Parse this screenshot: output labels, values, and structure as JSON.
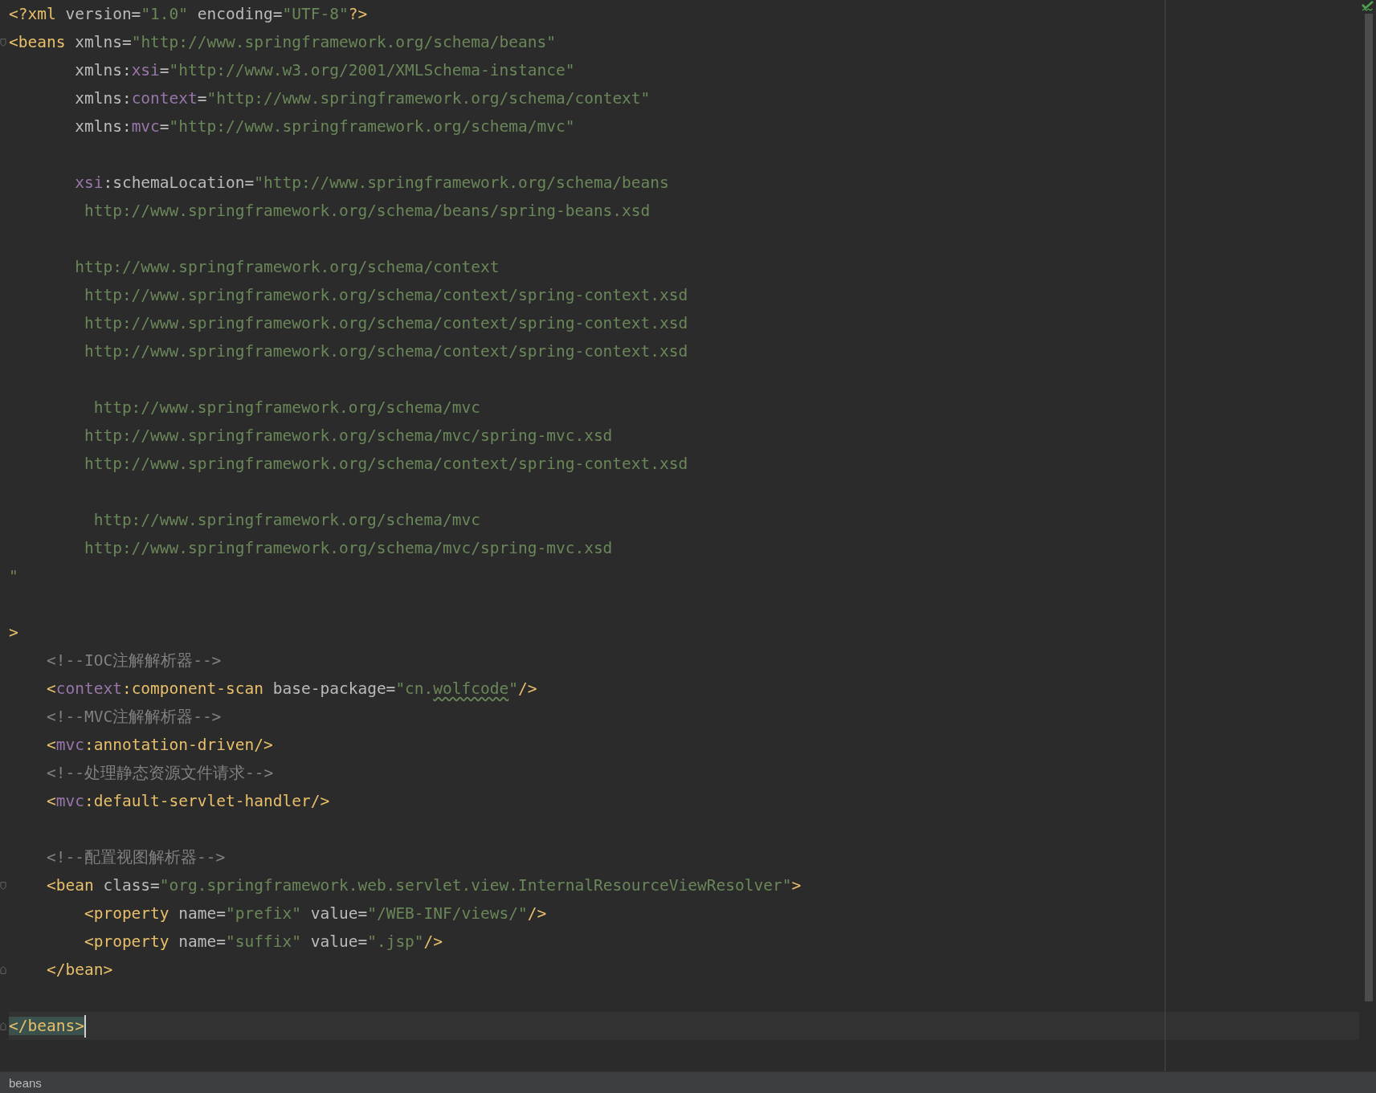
{
  "editor": {
    "lines": [
      {
        "kind": "plain",
        "current": false,
        "tokens": [
          {
            "kind": "tag",
            "text": "<?xml"
          },
          {
            "kind": "attr",
            "text": " version="
          },
          {
            "kind": "value",
            "text": "\"1.0\""
          },
          {
            "kind": "attr",
            "text": " encoding="
          },
          {
            "kind": "value",
            "text": "\"UTF-8\""
          },
          {
            "kind": "tag",
            "text": "?>"
          }
        ]
      },
      {
        "kind": "fold-start",
        "current": false,
        "tokens": [
          {
            "kind": "tag",
            "text": "<beans"
          },
          {
            "kind": "attr",
            "text": " xmlns="
          },
          {
            "kind": "value",
            "text": "\"http://www.springframework.org/schema/beans\""
          }
        ]
      },
      {
        "kind": "plain",
        "current": false,
        "tokens": [
          {
            "kind": "attr",
            "text": "       xmlns:"
          },
          {
            "kind": "ns",
            "text": "xsi"
          },
          {
            "kind": "attr",
            "text": "="
          },
          {
            "kind": "value",
            "text": "\"http://www.w3.org/2001/XMLSchema-instance\""
          }
        ]
      },
      {
        "kind": "plain",
        "current": false,
        "tokens": [
          {
            "kind": "attr",
            "text": "       xmlns:"
          },
          {
            "kind": "ns",
            "text": "context"
          },
          {
            "kind": "attr",
            "text": "="
          },
          {
            "kind": "value",
            "text": "\"http://www.springframework.org/schema/context\""
          }
        ]
      },
      {
        "kind": "plain",
        "current": false,
        "tokens": [
          {
            "kind": "attr",
            "text": "       xmlns:"
          },
          {
            "kind": "ns",
            "text": "mvc"
          },
          {
            "kind": "attr",
            "text": "="
          },
          {
            "kind": "value",
            "text": "\"http://www.springframework.org/schema/mvc\""
          }
        ]
      },
      {
        "kind": "plain",
        "current": false
      },
      {
        "kind": "plain",
        "current": false,
        "tokens": [
          {
            "kind": "ns",
            "text": "       xsi"
          },
          {
            "kind": "attr",
            "text": ":schemaLocation="
          },
          {
            "kind": "value",
            "text": "\"http://www.springframework.org/schema/beans"
          }
        ]
      },
      {
        "kind": "plain",
        "current": false,
        "tokens": [
          {
            "kind": "value",
            "text": "        http://www.springframework.org/schema/beans/spring-beans.xsd"
          }
        ]
      },
      {
        "kind": "plain",
        "current": false
      },
      {
        "kind": "plain",
        "current": false,
        "tokens": [
          {
            "kind": "value",
            "text": "       http://www.springframework.org/schema/context"
          }
        ]
      },
      {
        "kind": "plain",
        "current": false,
        "tokens": [
          {
            "kind": "value",
            "text": "        http://www.springframework.org/schema/context/spring-context.xsd"
          }
        ]
      },
      {
        "kind": "plain",
        "current": false,
        "tokens": [
          {
            "kind": "value",
            "text": "        http://www.springframework.org/schema/context/spring-context.xsd"
          }
        ]
      },
      {
        "kind": "plain",
        "current": false,
        "tokens": [
          {
            "kind": "value",
            "text": "        http://www.springframework.org/schema/context/spring-context.xsd"
          }
        ]
      },
      {
        "kind": "plain",
        "current": false
      },
      {
        "kind": "plain",
        "current": false,
        "tokens": [
          {
            "kind": "value",
            "text": "         http://www.springframework.org/schema/mvc"
          }
        ]
      },
      {
        "kind": "plain",
        "current": false,
        "tokens": [
          {
            "kind": "value",
            "text": "        http://www.springframework.org/schema/mvc/spring-mvc.xsd"
          }
        ]
      },
      {
        "kind": "plain",
        "current": false,
        "tokens": [
          {
            "kind": "value",
            "text": "        http://www.springframework.org/schema/context/spring-context.xsd"
          }
        ]
      },
      {
        "kind": "plain",
        "current": false
      },
      {
        "kind": "plain",
        "current": false,
        "tokens": [
          {
            "kind": "value",
            "text": "         http://www.springframework.org/schema/mvc"
          }
        ]
      },
      {
        "kind": "plain",
        "current": false,
        "tokens": [
          {
            "kind": "value",
            "text": "        http://www.springframework.org/schema/mvc/spring-mvc.xsd"
          }
        ]
      },
      {
        "kind": "plain",
        "current": false,
        "tokens": [
          {
            "kind": "value",
            "text": "\""
          }
        ]
      },
      {
        "kind": "plain",
        "current": false
      },
      {
        "kind": "plain",
        "current": false,
        "tokens": [
          {
            "kind": "tag",
            "text": ">"
          }
        ]
      },
      {
        "kind": "plain",
        "current": false,
        "tokens": [
          {
            "kind": "comment",
            "text": "    <!--IOC注解解析器-->"
          }
        ]
      },
      {
        "kind": "plain",
        "current": false,
        "tokens": [
          {
            "kind": "tag",
            "text": "    <"
          },
          {
            "kind": "ns",
            "text": "context"
          },
          {
            "kind": "tag",
            "text": ":component-scan"
          },
          {
            "kind": "attr",
            "text": " base-package="
          },
          {
            "kind": "value",
            "text": "\"cn."
          },
          {
            "kind": "typo",
            "text": "wolfcode"
          },
          {
            "kind": "value",
            "text": "\""
          },
          {
            "kind": "tag",
            "text": "/>"
          }
        ]
      },
      {
        "kind": "plain",
        "current": false,
        "tokens": [
          {
            "kind": "comment",
            "text": "    <!--MVC注解解析器-->"
          }
        ]
      },
      {
        "kind": "plain",
        "current": false,
        "tokens": [
          {
            "kind": "tag",
            "text": "    <"
          },
          {
            "kind": "ns",
            "text": "mvc"
          },
          {
            "kind": "tag",
            "text": ":annotation-driven/>"
          }
        ]
      },
      {
        "kind": "plain",
        "current": false,
        "tokens": [
          {
            "kind": "comment",
            "text": "    <!--处理静态资源文件请求-->"
          }
        ]
      },
      {
        "kind": "plain",
        "current": false,
        "tokens": [
          {
            "kind": "tag",
            "text": "    <"
          },
          {
            "kind": "ns",
            "text": "mvc"
          },
          {
            "kind": "tag",
            "text": ":default-servlet-handler/>"
          }
        ]
      },
      {
        "kind": "plain",
        "current": false
      },
      {
        "kind": "plain",
        "current": false,
        "tokens": [
          {
            "kind": "comment",
            "text": "    <!--配置视图解析器-->"
          }
        ]
      },
      {
        "kind": "fold-start",
        "current": false,
        "tokens": [
          {
            "kind": "tag",
            "text": "    <bean"
          },
          {
            "kind": "attr",
            "text": " class="
          },
          {
            "kind": "value",
            "text": "\"org.springframework.web.servlet.view.InternalResourceViewResolver\""
          },
          {
            "kind": "tag",
            "text": ">"
          }
        ]
      },
      {
        "kind": "plain",
        "current": false,
        "tokens": [
          {
            "kind": "tag",
            "text": "        <property"
          },
          {
            "kind": "attr",
            "text": " name="
          },
          {
            "kind": "value",
            "text": "\"prefix\""
          },
          {
            "kind": "attr",
            "text": " value="
          },
          {
            "kind": "value",
            "text": "\"/WEB-INF/views/\""
          },
          {
            "kind": "tag",
            "text": "/>"
          }
        ]
      },
      {
        "kind": "plain",
        "current": false,
        "tokens": [
          {
            "kind": "tag",
            "text": "        <property"
          },
          {
            "kind": "attr",
            "text": " name="
          },
          {
            "kind": "value",
            "text": "\"suffix\""
          },
          {
            "kind": "attr",
            "text": " value="
          },
          {
            "kind": "value",
            "text": "\".jsp\""
          },
          {
            "kind": "tag",
            "text": "/>"
          }
        ]
      },
      {
        "kind": "fold-end",
        "current": false,
        "tokens": [
          {
            "kind": "tag",
            "text": "    </bean>"
          }
        ]
      },
      {
        "kind": "plain",
        "current": false
      },
      {
        "kind": "fold-end",
        "current": true,
        "tokens": [
          {
            "kind": "match",
            "text": "</beans>"
          }
        ]
      }
    ]
  },
  "status_bar": {
    "breadcrumb": "beans"
  }
}
